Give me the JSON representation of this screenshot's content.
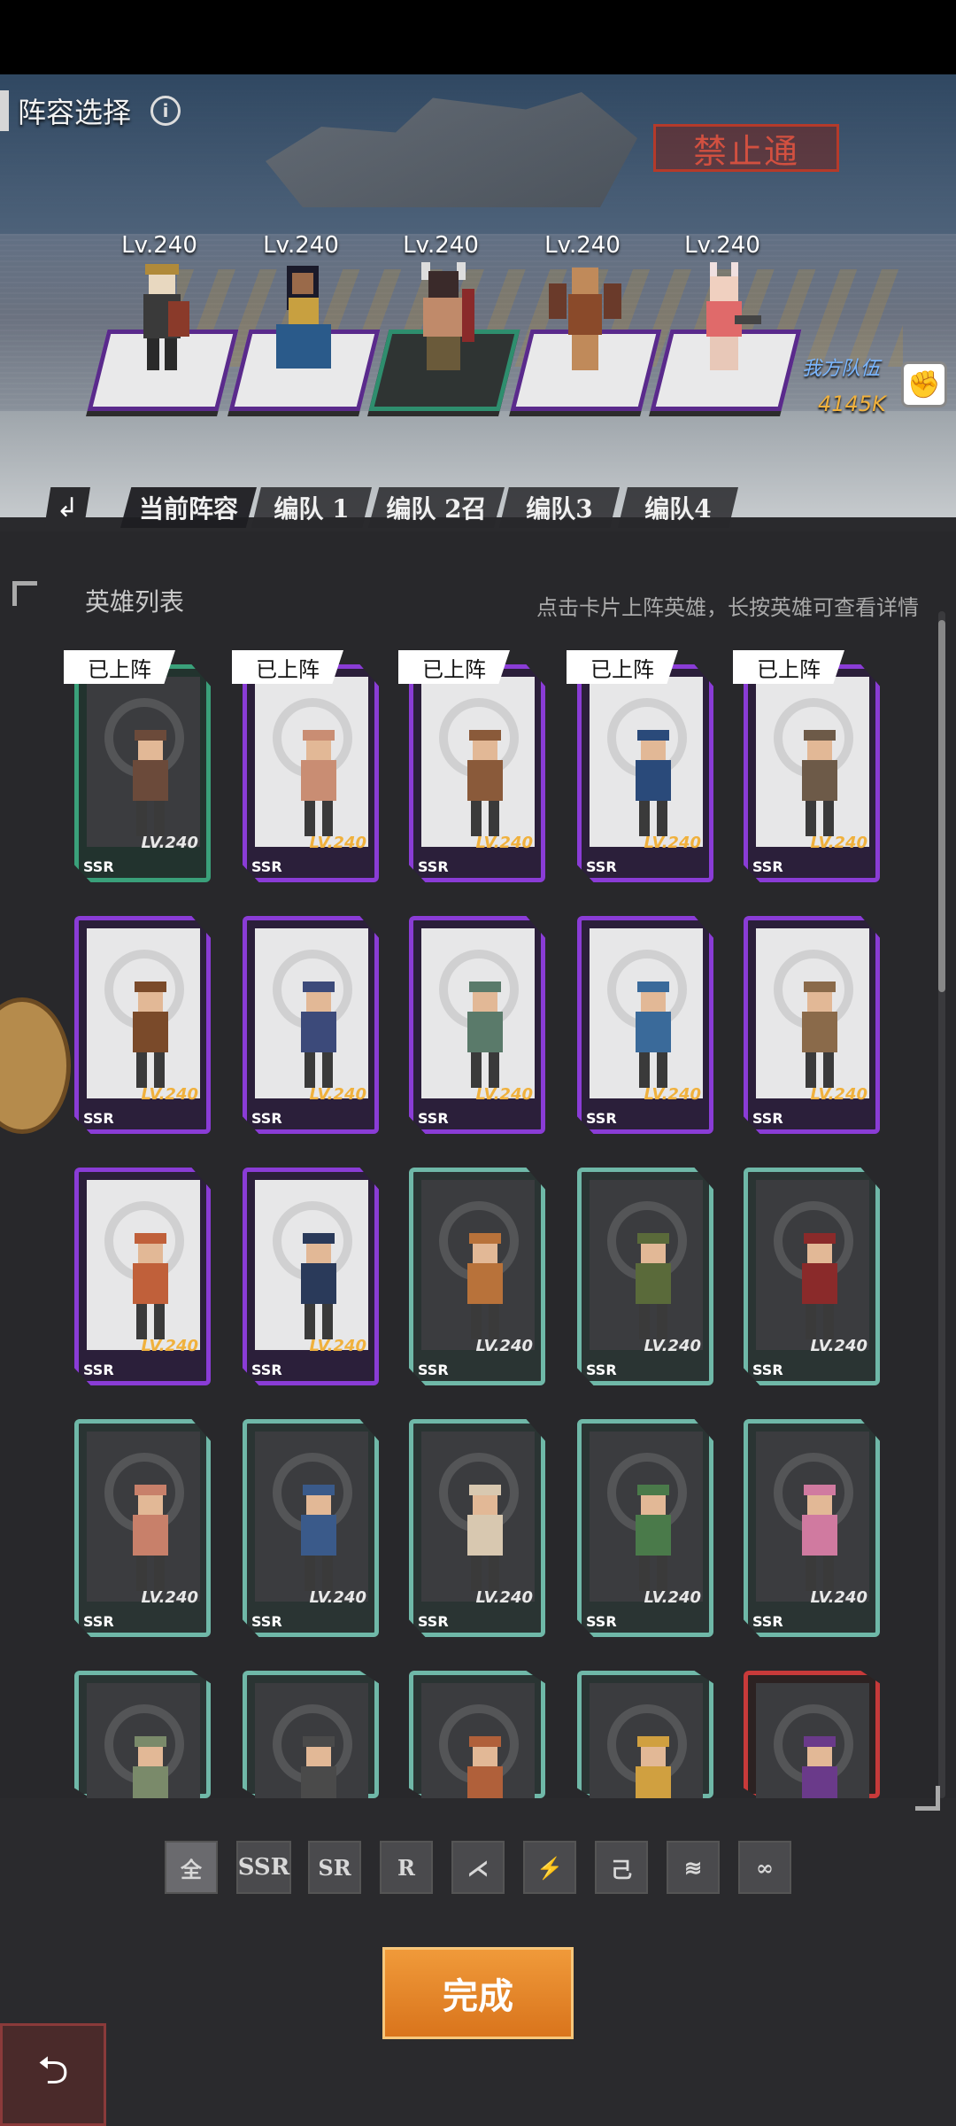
{
  "header": {
    "title": "阵容选择",
    "info_icon": "info-icon",
    "sign_text": "禁止通",
    "team_label": "我方队伍",
    "team_power": "4145K"
  },
  "slots": [
    {
      "level": "Lv.240",
      "hero": "hero-armored-maiden",
      "pad": "purple"
    },
    {
      "level": "Lv.240",
      "hero": "hero-serpent-queen",
      "pad": "purple"
    },
    {
      "level": "Lv.240",
      "hero": "hero-horned-brute",
      "pad": "green"
    },
    {
      "level": "Lv.240",
      "hero": "hero-winged-warrior",
      "pad": "purple"
    },
    {
      "level": "Lv.240",
      "hero": "hero-bunny-gunner",
      "pad": "purple"
    }
  ],
  "tabs": [
    {
      "label": "当前阵容",
      "active": true
    },
    {
      "label": "编队 1"
    },
    {
      "label": "编队 2召"
    },
    {
      "label": "编队3"
    },
    {
      "label": "编队4"
    }
  ],
  "list": {
    "title": "英雄列表",
    "hint": "点击卡片上阵英雄，长按英雄可查看详情"
  },
  "cards": [
    {
      "rarity": "SSR",
      "level": "LV.240",
      "frame": "green",
      "dark": true,
      "deployed": "已上阵",
      "hero": "#6b4a3a"
    },
    {
      "rarity": "SSR",
      "level": "LV.240",
      "frame": "purple",
      "dark": false,
      "deployed": "已上阵",
      "hero": "#c98d73"
    },
    {
      "rarity": "SSR",
      "level": "LV.240",
      "frame": "purple",
      "dark": false,
      "deployed": "已上阵",
      "hero": "#8a5a3a"
    },
    {
      "rarity": "SSR",
      "level": "LV.240",
      "frame": "purple",
      "dark": false,
      "deployed": "已上阵",
      "hero": "#2a4a7a"
    },
    {
      "rarity": "SSR",
      "level": "LV.240",
      "frame": "purple",
      "dark": false,
      "deployed": "已上阵",
      "hero": "#6d5a48"
    },
    {
      "rarity": "SSR",
      "level": "LV.240",
      "frame": "purple",
      "dark": false,
      "hero": "#7a4a2a"
    },
    {
      "rarity": "SSR",
      "level": "LV.240",
      "frame": "purple",
      "dark": false,
      "hero": "#3c4a7a"
    },
    {
      "rarity": "SSR",
      "level": "LV.240",
      "frame": "purple",
      "dark": false,
      "hero": "#5a7a6a"
    },
    {
      "rarity": "SSR",
      "level": "LV.240",
      "frame": "purple",
      "dark": false,
      "hero": "#3a6a9a"
    },
    {
      "rarity": "SSR",
      "level": "LV.240",
      "frame": "purple",
      "dark": false,
      "hero": "#8a6a4a"
    },
    {
      "rarity": "SSR",
      "level": "LV.240",
      "frame": "purple",
      "dark": false,
      "hero": "#c0603a"
    },
    {
      "rarity": "SSR",
      "level": "LV.240",
      "frame": "purple",
      "dark": false,
      "hero": "#2a3a5a"
    },
    {
      "rarity": "SSR",
      "level": "LV.240",
      "frame": "teal",
      "dark": true,
      "hero": "#b8723a"
    },
    {
      "rarity": "SSR",
      "level": "LV.240",
      "frame": "teal",
      "dark": true,
      "hero": "#5a6a3a"
    },
    {
      "rarity": "SSR",
      "level": "LV.240",
      "frame": "teal",
      "dark": true,
      "hero": "#8a2a2a"
    },
    {
      "rarity": "SSR",
      "level": "LV.240",
      "frame": "teal",
      "dark": true,
      "hero": "#c8806a"
    },
    {
      "rarity": "SSR",
      "level": "LV.240",
      "frame": "teal",
      "dark": true,
      "hero": "#3a5a8a"
    },
    {
      "rarity": "SSR",
      "level": "LV.240",
      "frame": "teal",
      "dark": true,
      "hero": "#d8c8b0"
    },
    {
      "rarity": "SSR",
      "level": "LV.240",
      "frame": "teal",
      "dark": true,
      "hero": "#4a7a4a"
    },
    {
      "rarity": "SSR",
      "level": "LV.240",
      "frame": "teal",
      "dark": true,
      "hero": "#d07aa0"
    },
    {
      "rarity": "",
      "level": "",
      "frame": "teal",
      "dark": true,
      "hero": "#7a8a6a"
    },
    {
      "rarity": "",
      "level": "",
      "frame": "teal",
      "dark": true,
      "hero": "#4a4a4a"
    },
    {
      "rarity": "",
      "level": "",
      "frame": "teal",
      "dark": true,
      "hero": "#b0603a"
    },
    {
      "rarity": "",
      "level": "",
      "frame": "teal",
      "dark": true,
      "hero": "#d0a040"
    },
    {
      "rarity": "",
      "level": "",
      "frame": "red",
      "dark": true,
      "hero": "#6a3a8a"
    }
  ],
  "filters": [
    {
      "label": "全",
      "active": true
    },
    {
      "label": "SSR"
    },
    {
      "label": "SR"
    },
    {
      "label": "R"
    },
    {
      "label": "",
      "icon": "faction-claw-icon"
    },
    {
      "label": "",
      "icon": "faction-wolf-icon"
    },
    {
      "label": "",
      "icon": "faction-serpent-icon"
    },
    {
      "label": "",
      "icon": "faction-wing-icon"
    },
    {
      "label": "",
      "icon": "faction-infinity-icon"
    }
  ],
  "done_label": "完成",
  "colors": {
    "accent_orange": "#e0801f",
    "frame_purple": "#8a3cd6",
    "frame_green": "#3aa07a",
    "level_gold": "#f0b13d"
  }
}
